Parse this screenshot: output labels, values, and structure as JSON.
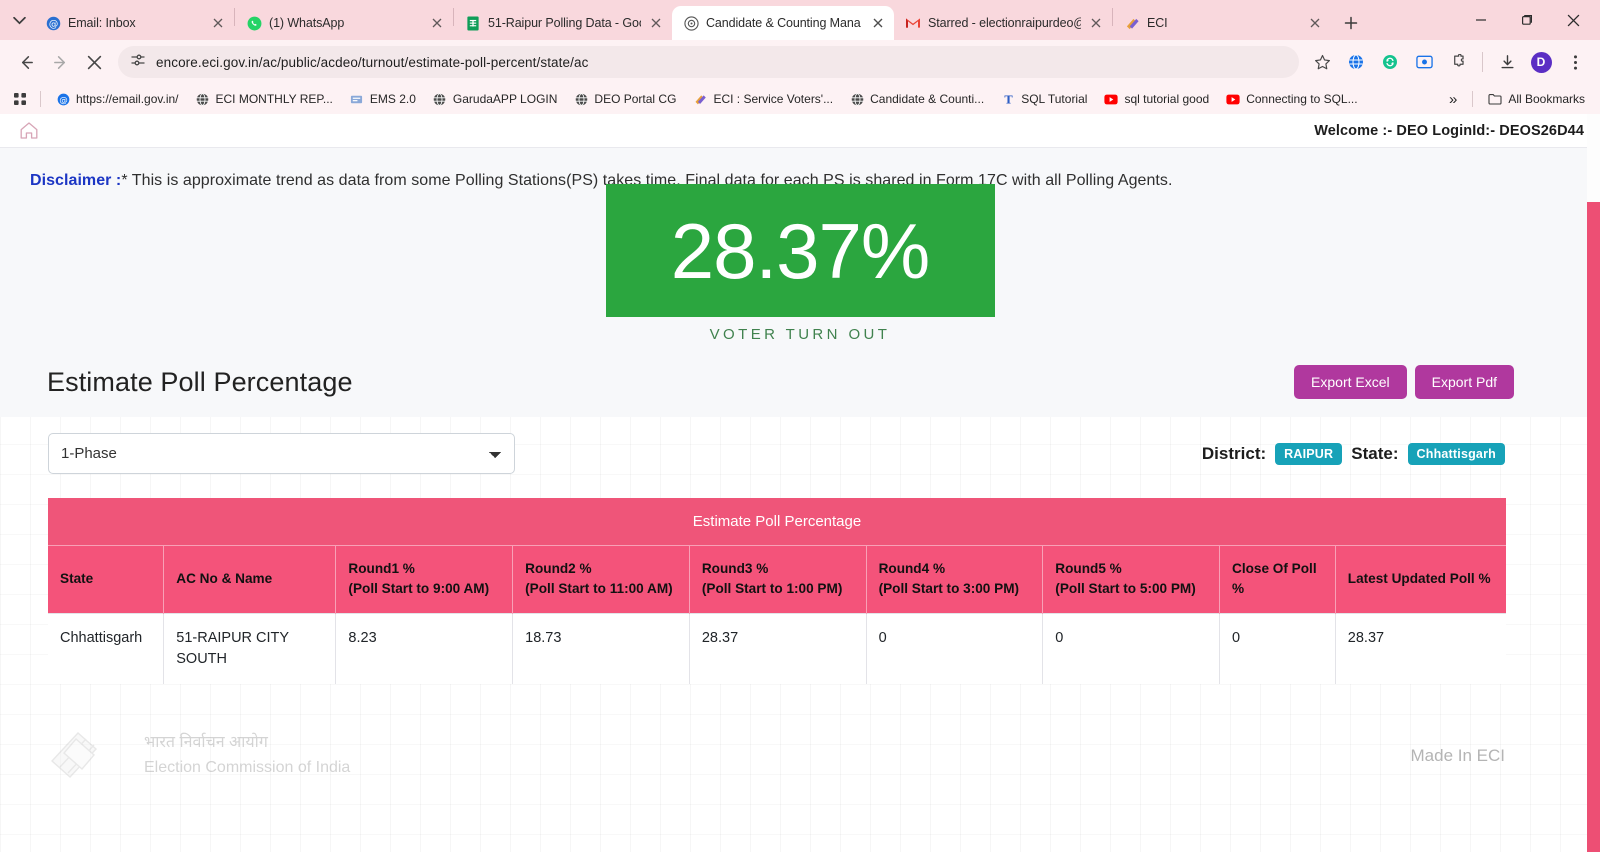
{
  "browser": {
    "tabs": [
      {
        "title": "Email: Inbox",
        "favicon": "mail-icon",
        "active": false
      },
      {
        "title": "(1) WhatsApp",
        "favicon": "whatsapp-icon",
        "active": false
      },
      {
        "title": "51-Raipur Polling Data - Goo",
        "favicon": "google-sheets-icon",
        "active": false
      },
      {
        "title": "Candidate & Counting Mana",
        "favicon": "eci-icon",
        "active": true
      },
      {
        "title": "Starred - electionraipurdeo@",
        "favicon": "gmail-icon",
        "active": false
      },
      {
        "title": "ECI",
        "favicon": "eci-leaf-icon",
        "active": false
      }
    ],
    "url": "encore.eci.gov.in/ac/public/acdeo/turnout/estimate-poll-percent/state/ac",
    "profile_initial": "D",
    "bookmarks": [
      {
        "label": "https://email.gov.in/",
        "favicon": "at-icon"
      },
      {
        "label": "ECI MONTHLY REP...",
        "favicon": "globe-icon"
      },
      {
        "label": "EMS 2.0",
        "favicon": "ems-icon"
      },
      {
        "label": "GarudaAPP LOGIN",
        "favicon": "globe-icon"
      },
      {
        "label": "DEO Portal CG",
        "favicon": "globe-icon"
      },
      {
        "label": "ECI : Service Voters'...",
        "favicon": "eci-leaf-icon"
      },
      {
        "label": "Candidate & Counti...",
        "favicon": "globe-icon"
      },
      {
        "label": "SQL Tutorial",
        "favicon": "t-icon"
      },
      {
        "label": "sql tutorial good",
        "favicon": "youtube-icon"
      },
      {
        "label": "Connecting to SQL...",
        "favicon": "youtube-icon"
      }
    ],
    "all_bookmarks_label": "All Bookmarks",
    "overflow_label": "»"
  },
  "app": {
    "welcome": "Welcome :- DEO LoginId:- DEOS26D44",
    "disclaimer_label": "Disclaimer :",
    "disclaimer_text": "* This is approximate trend as data from some Polling Stations(PS) takes time. Final data for each PS is shared in Form 17C with all Polling Agents.",
    "turnout_value": "28.37%",
    "turnout_label": "VOTER TURN OUT",
    "page_title": "Estimate Poll Percentage",
    "export_excel": "Export Excel",
    "export_pdf": "Export Pdf",
    "phase_selected": "1-Phase",
    "phase_options": [
      "1-Phase"
    ],
    "district_label": "District:",
    "district_value": "RAIPUR",
    "state_label": "State:",
    "state_value": "Chhattisgarh",
    "accent_green": "#2ba63f",
    "accent_pink": "#f4537a",
    "accent_magenta": "#b0389e",
    "accent_teal": "#17a2b8"
  },
  "table": {
    "caption": "Estimate Poll Percentage",
    "headers": [
      "State",
      "AC No & Name",
      "Round1 %\n(Poll Start to 9:00 AM)",
      "Round2 %\n(Poll Start to 11:00 AM)",
      "Round3 %\n(Poll Start to 1:00 PM)",
      "Round4 %\n(Poll Start to 3:00 PM)",
      "Round5 %\n(Poll Start to 5:00 PM)",
      "Close Of Poll %",
      "Latest Updated Poll %"
    ],
    "rows": [
      {
        "state": "Chhattisgarh",
        "ac": "51-RAIPUR CITY SOUTH",
        "round1": "8.23",
        "round2": "18.73",
        "round3": "28.37",
        "round4": "0",
        "round5": "0",
        "close_of_poll": "0",
        "latest": "28.37"
      }
    ]
  },
  "footer": {
    "org_hindi": "भारत निर्वाचन आयोग",
    "org_english": "Election Commission of India",
    "made_in": "Made In ECI"
  }
}
